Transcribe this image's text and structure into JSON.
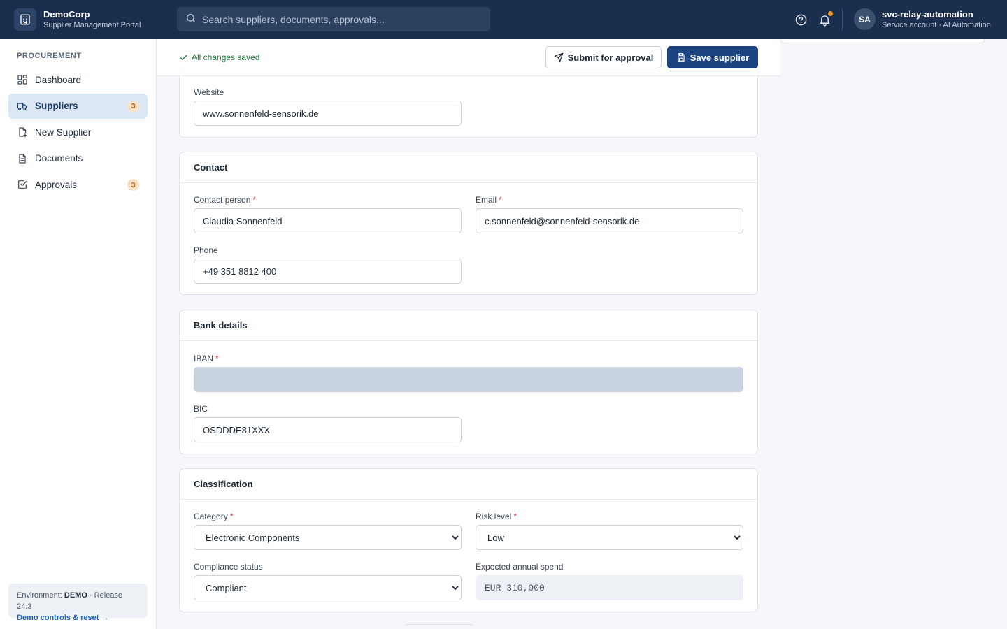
{
  "brand": {
    "name": "DemoCorp",
    "subtitle": "Supplier Management Portal"
  },
  "search": {
    "placeholder": "Search suppliers, documents, approvals..."
  },
  "user": {
    "initials": "SA",
    "name": "svc-relay-automation",
    "role": "Service account · AI Automation"
  },
  "sidebar": {
    "heading": "PROCUREMENT",
    "items": [
      {
        "label": "Dashboard",
        "icon": "dashboard-icon",
        "badge": ""
      },
      {
        "label": "Suppliers",
        "icon": "truck-icon",
        "badge": "3",
        "active": true
      },
      {
        "label": "New Supplier",
        "icon": "file-plus-icon",
        "badge": ""
      },
      {
        "label": "Documents",
        "icon": "document-icon",
        "badge": ""
      },
      {
        "label": "Approvals",
        "icon": "checkbox-icon",
        "badge": "3"
      }
    ],
    "env": {
      "prefix": "Environment:",
      "env": "DEMO",
      "release": "· Release 24.3",
      "link": "Demo controls & reset →"
    }
  },
  "action_bar": {
    "status": "All changes saved",
    "submit_label": "Submit for approval",
    "save_label": "Save supplier"
  },
  "website_card": {
    "label": "Website",
    "value": "www.sonnenfeld-sensorik.de"
  },
  "contact_card": {
    "title": "Contact",
    "contact_person_label": "Contact person",
    "contact_person_value": "Claudia Sonnenfeld",
    "email_label": "Email",
    "email_value": "c.sonnenfeld@sonnenfeld-sensorik.de",
    "phone_label": "Phone",
    "phone_value": "+49 351 8812 400"
  },
  "bank_card": {
    "title": "Bank details",
    "iban_label": "IBAN",
    "iban_value": "",
    "bic_label": "BIC",
    "bic_value": "OSDDDE81XXX"
  },
  "classification_card": {
    "title": "Classification",
    "category_label": "Category",
    "category_value": "Electronic Components",
    "risk_label": "Risk level",
    "risk_value": "Low",
    "compliance_label": "Compliance status",
    "compliance_value": "Compliant",
    "spend_label": "Expected annual spend",
    "spend_value": "EUR 310,000"
  },
  "required_marker": "*"
}
